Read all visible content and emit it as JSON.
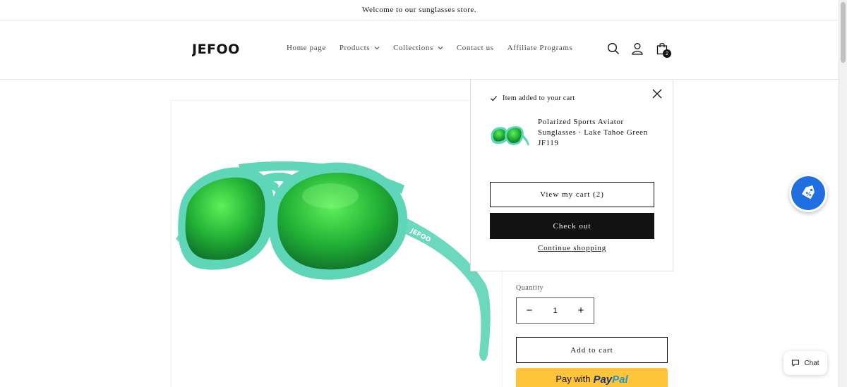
{
  "announcement": {
    "text": "Welcome to our sunglasses store."
  },
  "header": {
    "logo_text": "JEFOO",
    "nav": [
      {
        "label": "Home page",
        "has_dropdown": false
      },
      {
        "label": "Products",
        "has_dropdown": true
      },
      {
        "label": "Collections",
        "has_dropdown": true
      },
      {
        "label": "Contact us",
        "has_dropdown": false
      },
      {
        "label": "Affiliate Programs",
        "has_dropdown": false
      }
    ],
    "icons": [
      "search-icon",
      "account-icon",
      "cart-icon"
    ],
    "cart_count": "2"
  },
  "product": {
    "quantity_label": "Quantity",
    "quantity_value": "1",
    "quantity_minus": "−",
    "quantity_plus": "+",
    "add_to_cart": "Add to cart",
    "paypal_prefix": "Pay with",
    "paypal_brand_1": "Pay",
    "paypal_brand_2": "Pal"
  },
  "cart_popup": {
    "added_text": "Item added to your cart",
    "item_name": "Polarized Sports Aviator Sunglasses · Lake Tahoe Green JF119",
    "view_cart": "View my cart (2)",
    "checkout": "Check out",
    "continue": "Continue shopping"
  },
  "widgets": {
    "chat_label": "Chat",
    "discount_icon": "discount-tag-icon"
  },
  "colors": {
    "accent_dark": "#121212",
    "paypal_yellow": "#ffc43a",
    "discount_blue": "#1f6fe0",
    "lens_green": "#2fbf3a",
    "frame_teal": "#5fd6b8"
  }
}
